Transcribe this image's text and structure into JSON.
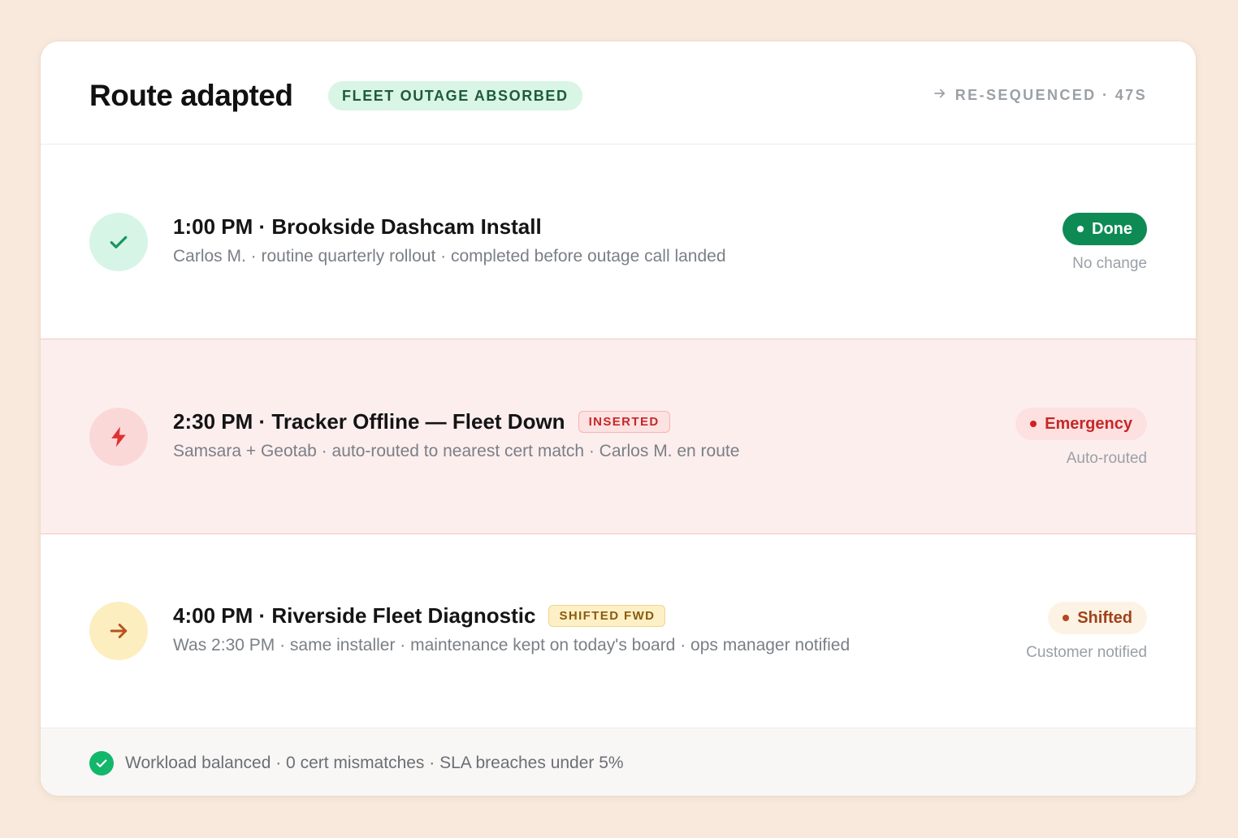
{
  "header": {
    "title": "Route adapted",
    "badge": "FLEET OUTAGE ABSORBED",
    "resequenced": "RE-SEQUENCED · 47S",
    "resequenced_icon": "arrow-right-icon"
  },
  "rows": [
    {
      "icon": "check-icon",
      "title": "1:00 PM · Brookside Dashcam Install",
      "tag": "",
      "subtitle": "Carlos M. · routine quarterly rollout · completed before outage call landed",
      "status": "Done",
      "note": "No change"
    },
    {
      "icon": "lightning-bolt-icon",
      "title": "2:30 PM · Tracker Offline — Fleet Down",
      "tag": "INSERTED",
      "subtitle": "Samsara + Geotab · auto-routed to nearest cert match · Carlos M. en route",
      "status": "Emergency",
      "note": "Auto-routed"
    },
    {
      "icon": "arrow-right-icon",
      "title": "4:00 PM · Riverside Fleet Diagnostic",
      "tag": "SHIFTED FWD",
      "subtitle": "Was 2:30 PM · same installer · maintenance kept on today's board · ops manager notified",
      "status": "Shifted",
      "note": "Customer notified"
    }
  ],
  "footer": {
    "icon": "check-circle-icon",
    "text": "Workload balanced · 0 cert mismatches · SLA breaches under 5%"
  },
  "colors": {
    "done": "#0e8a55",
    "emergency": "#c62828",
    "shifted": "#a0421a",
    "accent_green": "#12b76a",
    "page_background": "#f8e9dc"
  }
}
